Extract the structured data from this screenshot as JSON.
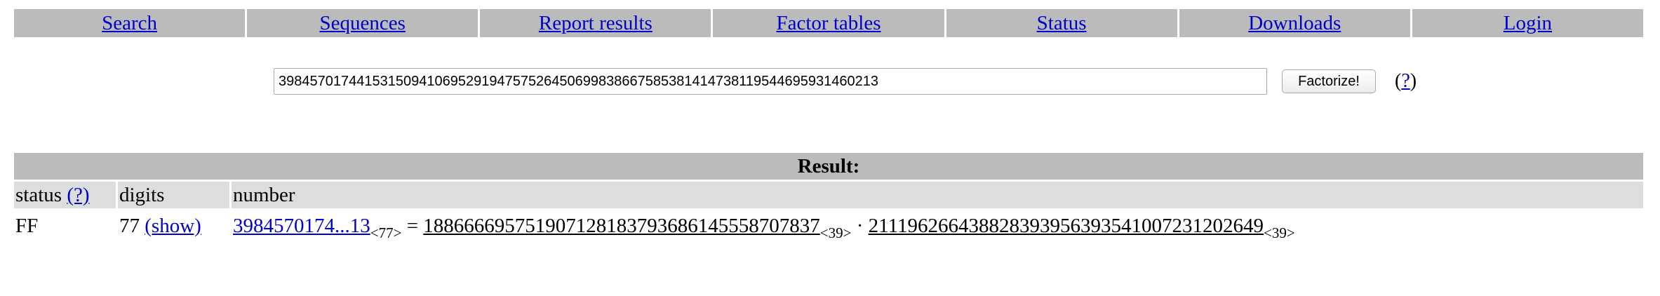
{
  "nav": {
    "items": [
      {
        "label": "Search"
      },
      {
        "label": "Sequences"
      },
      {
        "label": "Report results"
      },
      {
        "label": "Factor tables"
      },
      {
        "label": "Status"
      },
      {
        "label": "Downloads"
      },
      {
        "label": "Login"
      }
    ]
  },
  "search": {
    "value": "39845701744153150941069529194757526450699838667585381414738119544695931460213",
    "button_label": "Factorize!",
    "help_prefix": "(",
    "help_link": "?",
    "help_suffix": ")"
  },
  "result": {
    "header": "Result:",
    "columns": {
      "status": "status",
      "status_help": "(?)",
      "digits": "digits",
      "number": "number"
    },
    "row": {
      "status": "FF",
      "digits": "77",
      "show_link": "(show)",
      "number_short": "3984570174...13",
      "number_digits": "<77>",
      "equals": "=",
      "factor1": "188666695751907128183793686145558707837",
      "factor1_digits": "<39>",
      "times": "·",
      "factor2": "211196266438828393956393541007231202649",
      "factor2_digits": "<39>"
    }
  },
  "colors": {
    "nav_bg": "#bbbbbb",
    "header_bg": "#dddddd",
    "link": "#0000cc"
  }
}
